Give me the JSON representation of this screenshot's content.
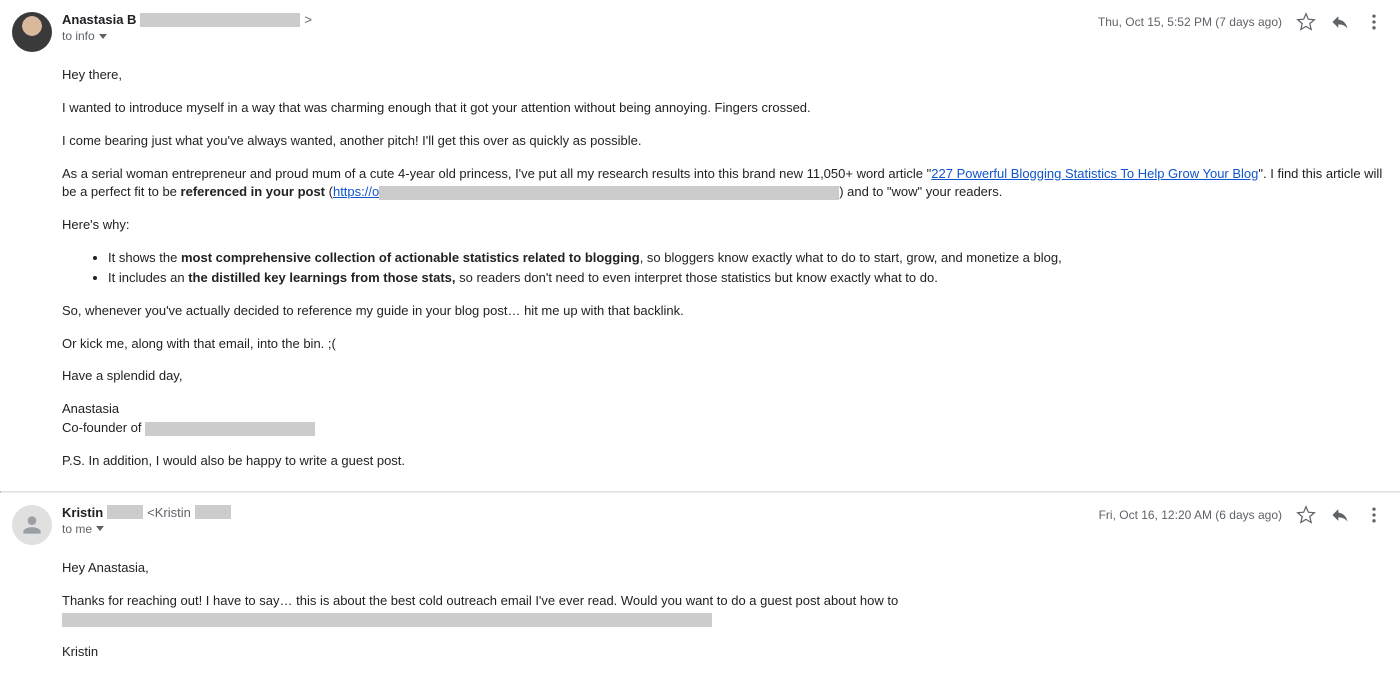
{
  "emails": [
    {
      "sender_name": "Anastasia B",
      "sender_suffix": ">",
      "to_label": "to info",
      "date": "Thu, Oct 15, 5:52 PM (7 days ago)",
      "greeting": "Hey there,",
      "p1": "I wanted to introduce myself in a way that was charming enough that it got your attention without being annoying. Fingers crossed.",
      "p2": "I come bearing just what you've always wanted, another pitch! I'll get this over as quickly as possible.",
      "p3a": "As a serial woman entrepreneur and proud mum of a cute 4-year old princess, I've put all my research results into this brand new 11,050+ word article  \"",
      "p3_link": "227 Powerful Blogging Statistics To Help Grow Your Blog",
      "p3b": "\". I find this article will be a perfect fit to be ",
      "p3_bold": "referenced in your post",
      "p3c": " (",
      "p3_link2": "https://o",
      "p3d": ") and to \"wow\" your readers.",
      "p4": "Here's why:",
      "li1a": "It shows the ",
      "li1b": "most comprehensive collection of actionable statistics related to blogging",
      "li1c": ", so bloggers know exactly what to do to start, grow, and monetize a blog,",
      "li2a": "It includes an ",
      "li2b": "the distilled key learnings from those stats,",
      "li2c": " so readers don't need to even interpret those statistics but know exactly what to do.",
      "p5": "So, whenever you've actually decided to reference my guide in your blog post… hit me up with that backlink.",
      "p6": "Or kick me, along with that email, into the bin. ;(",
      "p7": "Have a splendid day,",
      "sig1": "Anastasia",
      "sig2": "Co-founder of ",
      "ps": "P.S. In addition, I would also be happy to write a guest post."
    },
    {
      "sender_name": "Kristin",
      "sender_mid": "<Kristin",
      "to_label": "to me",
      "date": "Fri, Oct 16, 12:20 AM (6 days ago)",
      "greeting": "Hey Anastasia,",
      "p1": "Thanks for reaching out! I have to say… this is about the best cold outreach email I've ever read. Would you want to do a guest post about how to ",
      "sig": "Kristin"
    }
  ]
}
